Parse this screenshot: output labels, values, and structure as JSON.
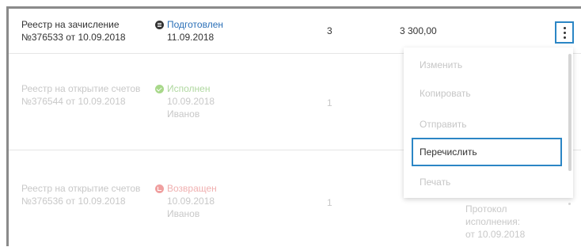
{
  "rows": [
    {
      "title_line1": "Реестр на зачисление",
      "title_line2": "№376533 от 10.09.2018",
      "status": "Подготовлен",
      "status_date": "11.09.2018",
      "count": "3",
      "amount": "3 300,00"
    },
    {
      "title_line1": "Реестр на открытие счетов",
      "title_line2": "№376544 от 10.09.2018",
      "status": "Исполнен",
      "status_date": "10.09.2018",
      "status_user": "Иванов",
      "count": "1"
    },
    {
      "title_line1": "Реестр на открытие счетов",
      "title_line2": "№376536 от 10.09.2018",
      "status": "Возвращен",
      "status_date": "10.09.2018",
      "status_user": "Иванов",
      "count": "1",
      "protocol_line1": "Протокол",
      "protocol_line2": "исполнения:",
      "protocol_line3": "от 10.09.2018"
    }
  ],
  "menu": {
    "items": [
      "Изменить",
      "Копировать",
      "Отправить",
      "Перечислить",
      "Печать"
    ],
    "active": "Перечислить"
  },
  "icons": {
    "kebab": "more-vertical-icon",
    "status_prepared": "document-icon",
    "status_done": "check-circle-icon",
    "status_returned": "return-icon"
  },
  "colors": {
    "accent": "#2b86c5",
    "link": "#2a6fb7",
    "success": "#a8d88a",
    "error": "#f0a0a0"
  }
}
